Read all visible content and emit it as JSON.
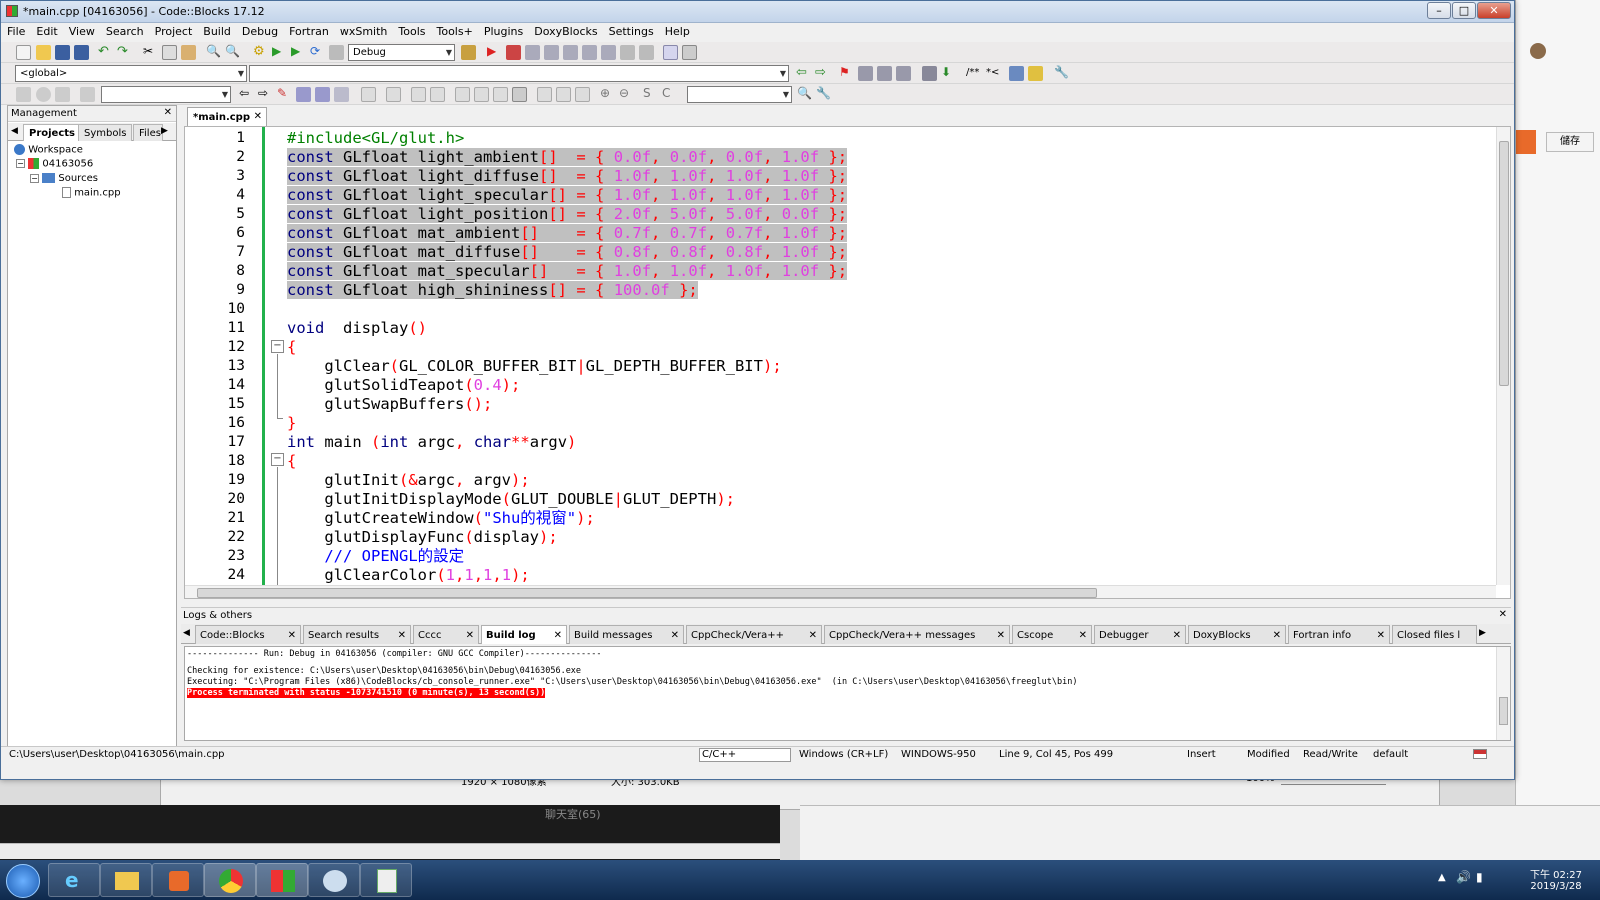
{
  "window": {
    "title": "*main.cpp [04163056] - Code::Blocks 17.12"
  },
  "menu": [
    "File",
    "Edit",
    "View",
    "Search",
    "Project",
    "Build",
    "Debug",
    "Fortran",
    "wxSmith",
    "Tools",
    "Tools+",
    "Plugins",
    "DoxyBlocks",
    "Settings",
    "Help"
  ],
  "toolbar": {
    "build_target": "Debug",
    "scope": "<global>"
  },
  "management": {
    "header": "Management",
    "tabs": [
      "Projects",
      "Symbols",
      "Files"
    ],
    "tree": {
      "workspace": "Workspace",
      "project": "04163056",
      "folder": "Sources",
      "file": "main.cpp"
    }
  },
  "editor": {
    "tab": "*main.cpp",
    "line_numbers": [
      "1",
      "2",
      "3",
      "4",
      "5",
      "6",
      "7",
      "8",
      "9",
      "10",
      "11",
      "12",
      "13",
      "14",
      "15",
      "16",
      "17",
      "18",
      "19",
      "20",
      "21",
      "22",
      "23",
      "24"
    ],
    "lines": [
      "#include<GL/glut.h>",
      "const GLfloat light_ambient[]  = { 0.0f, 0.0f, 0.0f, 1.0f };",
      "const GLfloat light_diffuse[]  = { 1.0f, 1.0f, 1.0f, 1.0f };",
      "const GLfloat light_specular[] = { 1.0f, 1.0f, 1.0f, 1.0f };",
      "const GLfloat light_position[] = { 2.0f, 5.0f, 5.0f, 0.0f };",
      "const GLfloat mat_ambient[]    = { 0.7f, 0.7f, 0.7f, 1.0f };",
      "const GLfloat mat_diffuse[]    = { 0.8f, 0.8f, 0.8f, 1.0f };",
      "const GLfloat mat_specular[]   = { 1.0f, 1.0f, 1.0f, 1.0f };",
      "const GLfloat high_shininess[] = { 100.0f };",
      "",
      "void  display()",
      "{",
      "    glClear(GL_COLOR_BUFFER_BIT|GL_DEPTH_BUFFER_BIT);",
      "    glutSolidTeapot(0.4);",
      "    glutSwapBuffers();",
      "}",
      "int main (int argc, char**argv)",
      "{",
      "    glutInit(&argc, argv);",
      "    glutInitDisplayMode(GLUT_DOUBLE|GLUT_DEPTH);",
      "    glutCreateWindow(\"Shu的視窗\");",
      "    glutDisplayFunc(display);",
      "    /// OPENGL的設定",
      "    glClearColor(1,1,1,1);"
    ]
  },
  "logs": {
    "header": "Logs & others",
    "tabs": [
      "Code::Blocks",
      "Search results",
      "Cccc",
      "Build log",
      "Build messages",
      "CppCheck/Vera++",
      "CppCheck/Vera++ messages",
      "Cscope",
      "Debugger",
      "DoxyBlocks",
      "Fortran info",
      "Closed files l"
    ],
    "active_tab": "Build log",
    "lines": [
      "-------------- Run: Debug in 04163056 (compiler: GNU GCC Compiler)---------------",
      "Checking for existence: C:\\Users\\user\\Desktop\\04163056\\bin\\Debug\\04163056.exe",
      "Executing: \"C:\\Program Files (x86)\\CodeBlocks/cb_console_runner.exe\" \"C:\\Users\\user\\Desktop\\04163056\\bin\\Debug\\04163056.exe\"  (in C:\\Users\\user\\Desktop\\04163056\\freeglut\\bin)",
      "Process terminated with status -1073741510 (0 minute(s), 13 second(s))"
    ]
  },
  "statusbar": {
    "path": "C:\\Users\\user\\Desktop\\04163056\\main.cpp",
    "language": "C/C++",
    "eol": "Windows (CR+LF)",
    "encoding": "WINDOWS-950",
    "position": "Line 9, Col 45, Pos 499",
    "insert": "Insert",
    "modified": "Modified",
    "rw": "Read/Write",
    "profile": "default"
  },
  "background": {
    "image_size": "1920 × 1080像素",
    "file_size": "大小: 303.0KB",
    "zoom": "100%",
    "chat": "聊天室(65)",
    "btn_save": "儲存"
  },
  "taskbar": {
    "time": "下午 02:27",
    "date": "2019/3/28"
  },
  "colors": {
    "keyword": "#00007f",
    "number": "#e040e0",
    "operator": "#ff0000",
    "string": "#0000ff",
    "selection": "#c0c0c0",
    "changebar": "#22b14c",
    "error_bg": "#ff0000"
  }
}
